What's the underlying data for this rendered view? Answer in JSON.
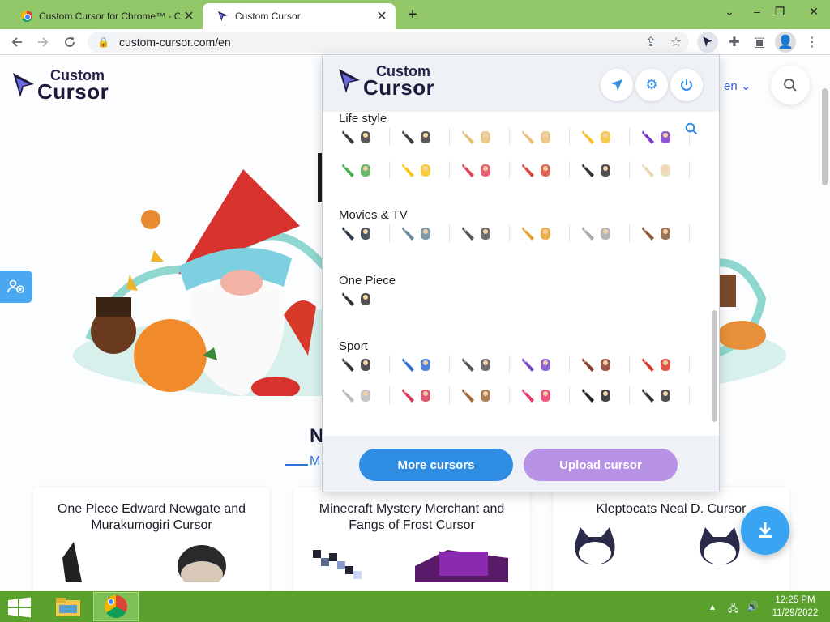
{
  "browser": {
    "tabs": [
      {
        "title": "Custom Cursor for Chrome™ - C",
        "active": false
      },
      {
        "title": "Custom Cursor",
        "active": true
      }
    ],
    "new_tab_icon": "+",
    "url": "custom-cursor.com/en",
    "window_controls": {
      "chevron": "⌄",
      "minimize": "–",
      "restore": "❐",
      "close": "✕"
    }
  },
  "site": {
    "logo_small": "Custom",
    "logo_big": "Cursor",
    "language": "en",
    "section_title": "N",
    "section_subtitle": "M",
    "cards": [
      {
        "title": "One Piece Edward Newgate and Murakumogiri Cursor"
      },
      {
        "title": "Minecraft Mystery Merchant and Fangs of Frost Cursor"
      },
      {
        "title": "Kleptocats Neal D. Cursor"
      }
    ]
  },
  "popup": {
    "logo_small": "Custom",
    "logo_big": "Cursor",
    "categories": [
      {
        "title": "Life style",
        "rows": [
          [
            "#3c3c3c",
            "#3c3c3c",
            "#e8c07a",
            "#e8c07a",
            "#f2c230",
            "#7a3cc8"
          ],
          [
            "#4caf50",
            "#f5c518",
            "#e0455a",
            "#d94a3c",
            "#333333",
            "#e8d8b0"
          ]
        ]
      },
      {
        "title": "Movies & TV",
        "rows": [
          [
            "#2f3a4a",
            "#6a8a9a",
            "#555555",
            "#e8a030",
            "#aaaaaa",
            "#8a5a3a"
          ]
        ]
      },
      {
        "title": "One Piece",
        "rows": [
          [
            "#333333"
          ]
        ]
      },
      {
        "title": "Sport",
        "rows": [
          [
            "#333333",
            "#2f6fd6",
            "#555555",
            "#7a4ac8",
            "#8a3a2a",
            "#d83a2a"
          ],
          [
            "#bbbbbb",
            "#d83a5a",
            "#a06a3a",
            "#e83a6a",
            "#222222",
            "#333333"
          ]
        ]
      }
    ],
    "buttons": {
      "more": "More cursors",
      "upload": "Upload cursor"
    },
    "colors": {
      "more": "#2f8de4",
      "upload": "#b792e6"
    }
  },
  "taskbar": {
    "time": "12:25 PM",
    "date": "11/29/2022"
  }
}
